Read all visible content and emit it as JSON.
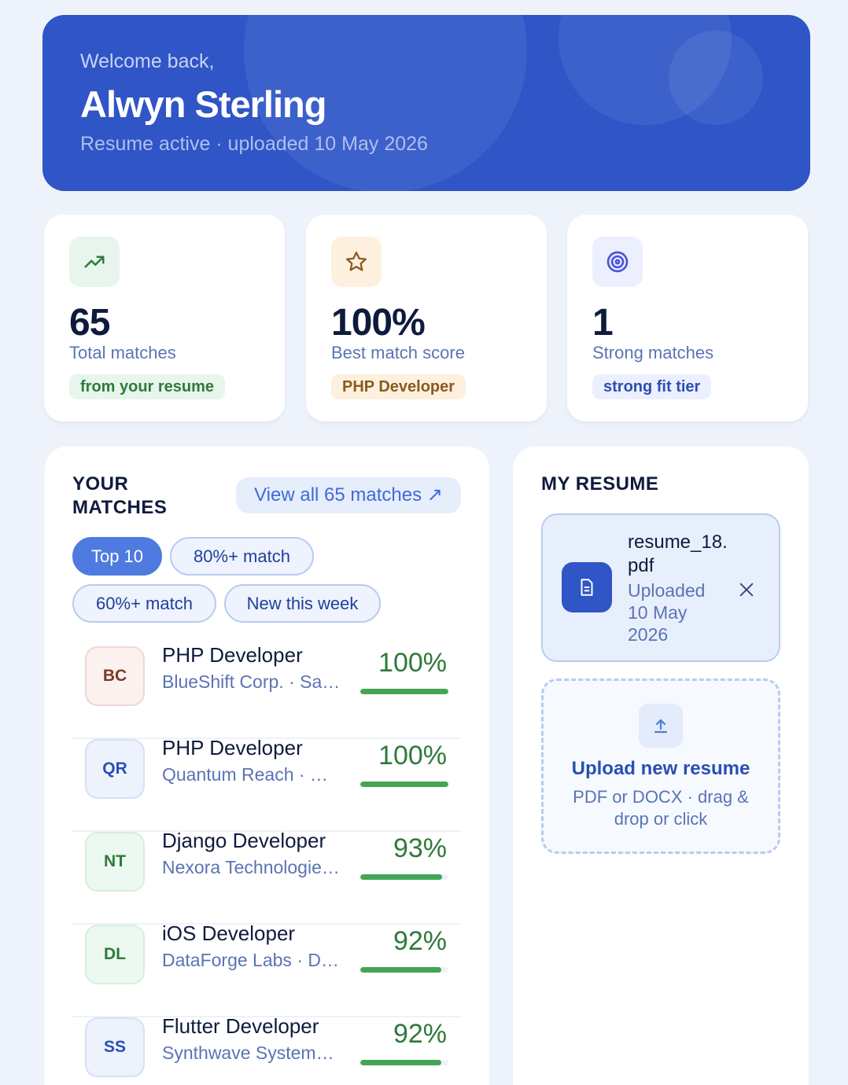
{
  "hero": {
    "welcome": "Welcome back,",
    "name": "Alwyn Sterling",
    "subtitle": "Resume active · uploaded 10 May 2026"
  },
  "stats": [
    {
      "icon": "trending-up-icon",
      "value": "65",
      "label": "Total matches",
      "pill": "from your resume",
      "accent": "#2f7a3a"
    },
    {
      "icon": "star-icon",
      "value": "100%",
      "label": "Best match score",
      "pill": "PHP Developer",
      "accent": "#8a5a1e"
    },
    {
      "icon": "target-icon",
      "value": "1",
      "label": "Strong matches",
      "pill": "strong fit tier",
      "accent": "#2a4fb3"
    }
  ],
  "matches": {
    "title": "YOUR MATCHES",
    "view_all": "View all 65 matches ↗",
    "filters": [
      "Top 10",
      "80%+ match",
      "60%+ match",
      "New this week"
    ],
    "active_filter": "Top 10",
    "rows": [
      {
        "initials": "BC",
        "title": "PHP Developer",
        "company": "BlueShift Corp. · San Francisco",
        "score": "100%",
        "score_value": 100
      },
      {
        "initials": "QR",
        "title": "PHP Developer",
        "company": "Quantum Reach · Miami",
        "score": "100%",
        "score_value": 100
      },
      {
        "initials": "NT",
        "title": "Django Developer",
        "company": "Nexora Technologies · Remote",
        "score": "93%",
        "score_value": 93
      },
      {
        "initials": "DL",
        "title": "iOS Developer",
        "company": "DataForge Labs · Dallas",
        "score": "92%",
        "score_value": 92
      },
      {
        "initials": "SS",
        "title": "Flutter Developer",
        "company": "Synthwave Systems · Remote",
        "score": "92%",
        "score_value": 92
      }
    ]
  },
  "resume": {
    "title": "MY RESUME",
    "file_name": "resume_18.pdf",
    "file_meta": "Uploaded 10 May 2026",
    "upload_title": "Upload new resume",
    "upload_sub": "PDF or DOCX · drag & drop or click"
  },
  "colors": {
    "brand": "#2f55c6",
    "accent": "#4f7be0",
    "success": "#43a656"
  }
}
